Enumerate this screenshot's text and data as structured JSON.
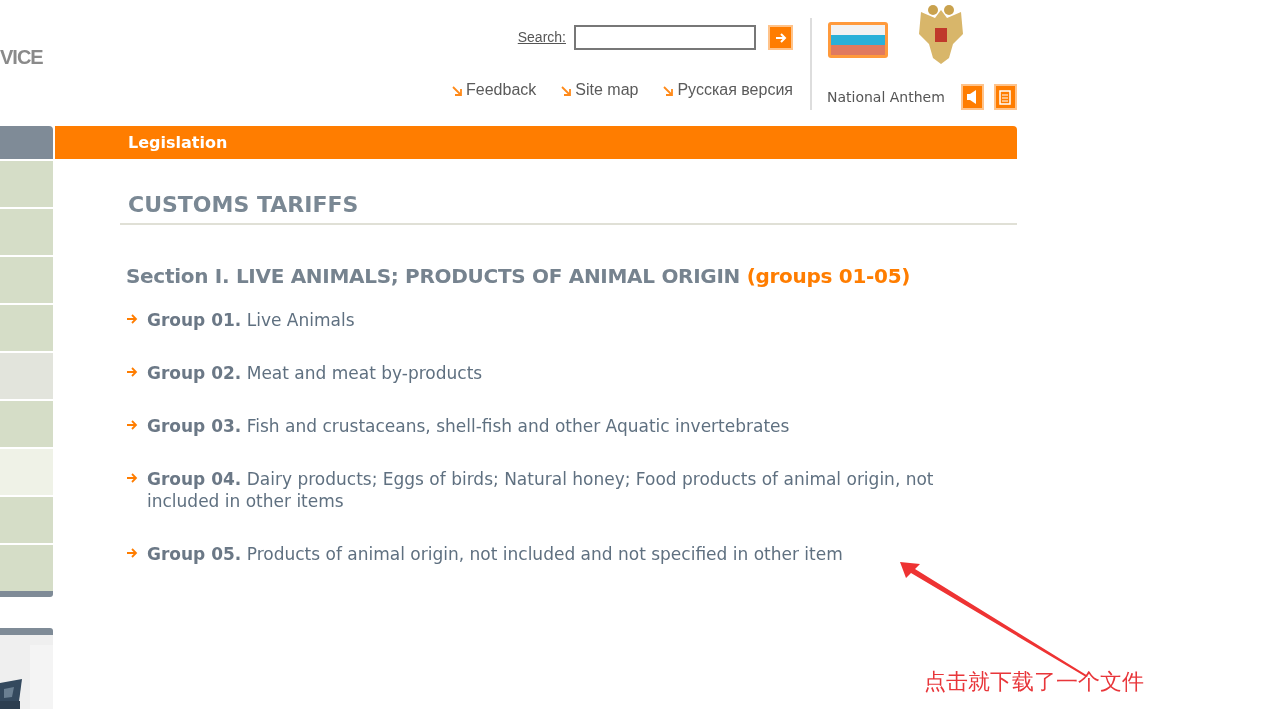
{
  "logo_text": "VICE",
  "search": {
    "label": "Search:"
  },
  "top_links": [
    {
      "label": "Feedback"
    },
    {
      "label": "Site map"
    },
    {
      "label": "Русская версия"
    }
  ],
  "anthem": {
    "label": "National Anthem"
  },
  "sidebar": {
    "items": [
      {
        "color": "#d5ddc7"
      },
      {
        "color": "#d5ddc7"
      },
      {
        "color": "#d5ddc7"
      },
      {
        "color": "#d5ddc7"
      },
      {
        "color": "#e2e4dc"
      },
      {
        "color": "#d5ddc7"
      },
      {
        "color": "#eff2e7"
      },
      {
        "color": "#d5ddc7"
      },
      {
        "color": "#d5ddc7"
      }
    ]
  },
  "breadcrumb": "Legislation",
  "page_title": "CUSTOMS TARIFFS",
  "section": {
    "title": "Section I. LIVE ANIMALS; PRODUCTS OF ANIMAL ORIGIN",
    "range": "(groups 01-05)"
  },
  "groups": [
    {
      "text": "**Group 01.** Live Animals"
    },
    {
      "text": "**Group 02.** Meat and meat by-products"
    },
    {
      "text": "**Group 03.** Fish and crustaceans, shell-fish and other Aquatic invertebrates"
    },
    {
      "text": "**Group 04.** Dairy products; Eggs of birds; Natural honey; Food products of animal origin, not included in other items"
    },
    {
      "text": "**Group 05.** Products of animal origin, not included and not specified in other item"
    }
  ],
  "annotation": {
    "text": "点击就下载了一个文件"
  }
}
